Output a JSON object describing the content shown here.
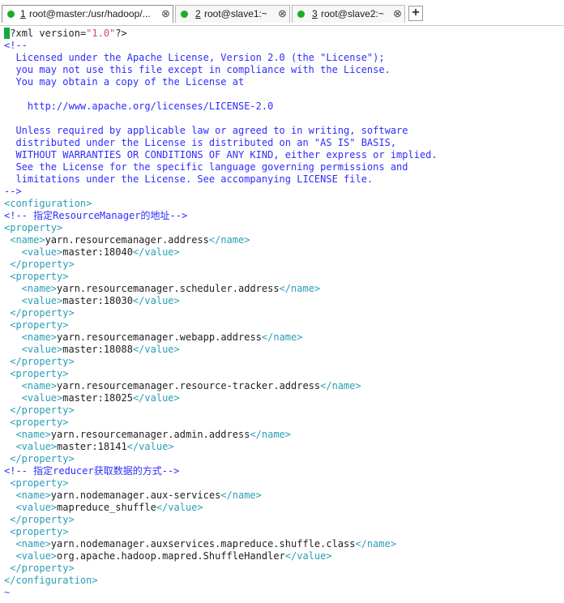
{
  "tabs": [
    {
      "number": "1",
      "title": "root@master:/usr/hadoop/...",
      "close": "⊗",
      "status": "connected"
    },
    {
      "number": "2",
      "title": "root@slave1:~",
      "close": "⊗",
      "status": "connected"
    },
    {
      "number": "3",
      "title": "root@slave2:~",
      "close": "⊗",
      "status": "connected"
    }
  ],
  "new_tab_label": "+",
  "colors": {
    "connected_dot": "#1aad2b",
    "tag": "#2a9db5",
    "comment": "#2d2dff",
    "attr_value": "#c94a7b"
  },
  "file": {
    "pi": {
      "open": "<?",
      "name": "xml",
      "attr": "version",
      "eq": "=",
      "value": "\"1.0\"",
      "close": "?>"
    },
    "license_comment": [
      "<!--",
      "  Licensed under the Apache License, Version 2.0 (the \"License\");",
      "  you may not use this file except in compliance with the License.",
      "  You may obtain a copy of the License at",
      "",
      "    http://www.apache.org/licenses/LICENSE-2.0",
      "",
      "  Unless required by applicable law or agreed to in writing, software",
      "  distributed under the License is distributed on an \"AS IS\" BASIS,",
      "  WITHOUT WARRANTIES OR CONDITIONS OF ANY KIND, either express or implied.",
      "  See the License for the specific language governing permissions and",
      "  limitations under the License. See accompanying LICENSE file.",
      "-->"
    ],
    "config_open": "<configuration>",
    "comment_rm": "<!-- 指定ResourceManager的地址-->",
    "p1_open": "<property>",
    "p1_name_open": " <name>",
    "p1_name": "yarn.resourcemanager.address",
    "p1_name_close": "</name>",
    "p1_value_open": "   <value>",
    "p1_value": "master:18040",
    "p1_value_close": "</value>",
    "p1_close": " </property>",
    "p2_open": " <property>",
    "p2_name_open": "   <name>",
    "p2_name": "yarn.resourcemanager.scheduler.address",
    "p2_name_close": "</name>",
    "p2_value_open": "   <value>",
    "p2_value": "master:18030",
    "p2_value_close": "</value>",
    "p2_close": " </property>",
    "p3_open": " <property>",
    "p3_name_open": "   <name>",
    "p3_name": "yarn.resourcemanager.webapp.address",
    "p3_name_close": "</name>",
    "p3_value_open": "   <value>",
    "p3_value": "master:18088",
    "p3_value_close": "</value>",
    "p3_close": " </property>",
    "p4_open": " <property>",
    "p4_name_open": "   <name>",
    "p4_name": "yarn.resourcemanager.resource-tracker.address",
    "p4_name_close": "</name>",
    "p4_value_open": "   <value>",
    "p4_value": "master:18025",
    "p4_value_close": "</value>",
    "p4_close": " </property>",
    "p5_open": " <property>",
    "p5_name_open": "  <name>",
    "p5_name": "yarn.resourcemanager.admin.address",
    "p5_name_close": "</name>",
    "p5_value_open": "  <value>",
    "p5_value": "master:18141",
    "p5_value_close": "</value>",
    "p5_close": " </property>",
    "comment_reducer": "<!-- 指定reducer获取数据的方式-->",
    "p6_open": " <property>",
    "p6_name_open": "  <name>",
    "p6_name": "yarn.nodemanager.aux-services",
    "p6_name_close": "</name>",
    "p6_value_open": "  <value>",
    "p6_value": "mapreduce_shuffle",
    "p6_value_close": "</value>",
    "p6_close": " </property>",
    "p7_open": " <property>",
    "p7_name_open": "  <name>",
    "p7_name": "yarn.nodemanager.auxservices.mapreduce.shuffle.class",
    "p7_name_close": "</name>",
    "p7_value_open": "  <value>",
    "p7_value": "org.apache.hadoop.mapred.ShuffleHandler",
    "p7_value_close": "</value>",
    "p7_close": " </property>",
    "config_close": "</configuration>",
    "tilde": "~"
  }
}
